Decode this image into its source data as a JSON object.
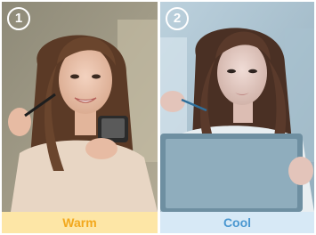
{
  "panels": [
    {
      "number": "1",
      "label": "Warm",
      "label_color": "#f2a81d",
      "label_bg": "#fde6a6"
    },
    {
      "number": "2",
      "label": "Cool",
      "label_color": "#4a97d0",
      "label_bg": "#d7e9f6"
    }
  ]
}
